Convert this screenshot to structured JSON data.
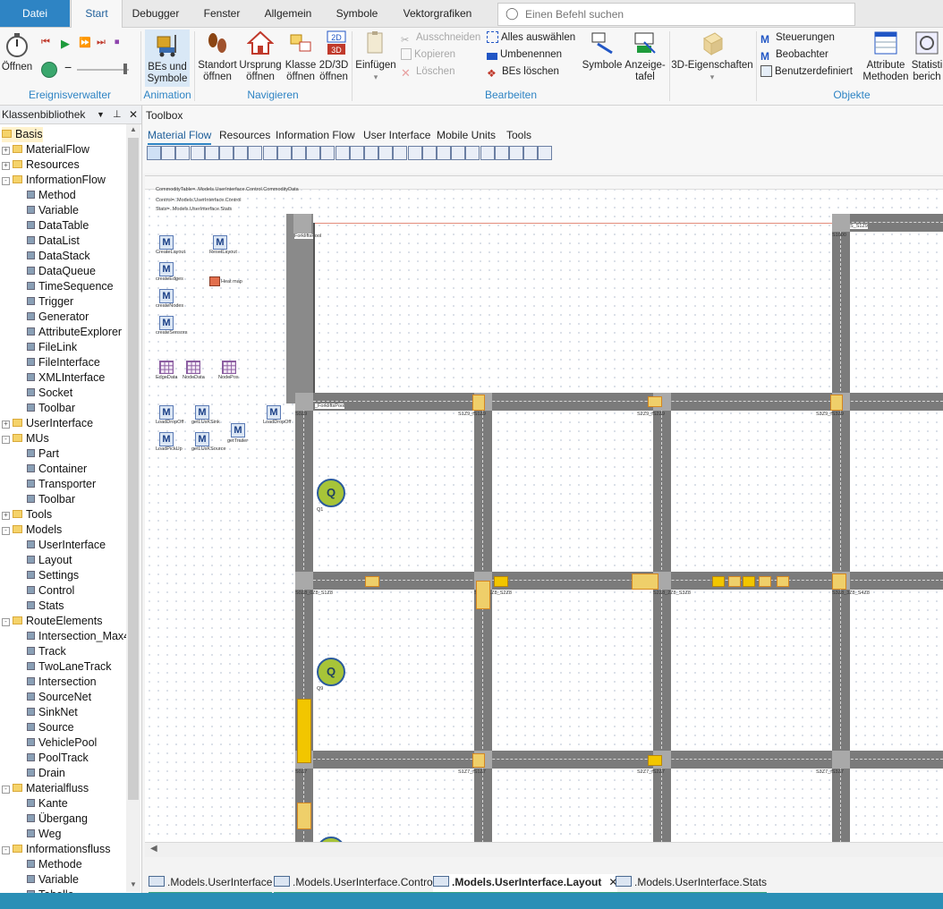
{
  "menu": {
    "tabs": [
      "Datei",
      "Start",
      "Debugger",
      "Fenster",
      "Allgemein",
      "Symbole",
      "Vektorgrafiken"
    ],
    "search_placeholder": "Einen Befehl suchen"
  },
  "ribbon": {
    "ereignis": {
      "open": "Öffnen",
      "group": "Ereignisverwalter"
    },
    "animation": {
      "bes_l1": "BEs und",
      "bes_l2": "Symbole",
      "group": "Animation"
    },
    "navigieren": {
      "standort_l1": "Standort",
      "standort_l2": "öffnen",
      "ursprung_l1": "Ursprung",
      "ursprung_l2": "öffnen",
      "klasse_l1": "Klasse",
      "klasse_l2": "öffnen",
      "view_l1": "2D/3D",
      "view_l2": "öffnen",
      "group": "Navigieren"
    },
    "bearbeiten": {
      "einfuegen": "Einfügen",
      "ausschneiden": "Ausschneiden",
      "kopieren": "Kopieren",
      "loeschen": "Löschen",
      "alles": "Alles auswählen",
      "umbenennen": "Umbenennen",
      "bes_loeschen": "BEs löschen",
      "symbole": "Symbole",
      "anzeige_l1": "Anzeige-",
      "anzeige_l2": "tafel",
      "group": "Bearbeiten"
    },
    "eigen": {
      "label": "3D-Eigenschaften"
    },
    "objekte": {
      "steuerungen": "Steuerungen",
      "beobachter": "Beobachter",
      "benutzer": "Benutzerdefiniert",
      "attr_l1": "Attribute",
      "attr_l2": "Methoden",
      "stat_l1": "Statisti",
      "stat_l2": "berich",
      "group": "Objekte"
    }
  },
  "leftpanel": {
    "title": "Klassenbibliothek",
    "items": [
      {
        "label": "Basis",
        "level": 0,
        "folder": true
      },
      {
        "label": "MaterialFlow",
        "level": 1,
        "folder": true,
        "exp": "+"
      },
      {
        "label": "Resources",
        "level": 1,
        "folder": true,
        "exp": "+"
      },
      {
        "label": "InformationFlow",
        "level": 1,
        "folder": true,
        "exp": "-"
      },
      {
        "label": "Method",
        "level": 2
      },
      {
        "label": "Variable",
        "level": 2
      },
      {
        "label": "DataTable",
        "level": 2
      },
      {
        "label": "DataList",
        "level": 2
      },
      {
        "label": "DataStack",
        "level": 2
      },
      {
        "label": "DataQueue",
        "level": 2
      },
      {
        "label": "TimeSequence",
        "level": 2
      },
      {
        "label": "Trigger",
        "level": 2
      },
      {
        "label": "Generator",
        "level": 2
      },
      {
        "label": "AttributeExplorer",
        "level": 2
      },
      {
        "label": "FileLink",
        "level": 2
      },
      {
        "label": "FileInterface",
        "level": 2
      },
      {
        "label": "XMLInterface",
        "level": 2
      },
      {
        "label": "Socket",
        "level": 2
      },
      {
        "label": "Toolbar",
        "level": 2
      },
      {
        "label": "UserInterface",
        "level": 1,
        "folder": true,
        "exp": "+"
      },
      {
        "label": "MUs",
        "level": 1,
        "folder": true,
        "exp": "-"
      },
      {
        "label": "Part",
        "level": 2
      },
      {
        "label": "Container",
        "level": 2
      },
      {
        "label": "Transporter",
        "level": 2
      },
      {
        "label": "Toolbar",
        "level": 2
      },
      {
        "label": "Tools",
        "level": 1,
        "folder": true,
        "exp": "+"
      },
      {
        "label": "Models",
        "level": 1,
        "folder": true,
        "exp": "-"
      },
      {
        "label": "UserInterface",
        "level": 2
      },
      {
        "label": "Layout",
        "level": 2
      },
      {
        "label": "Settings",
        "level": 2
      },
      {
        "label": "Control",
        "level": 2
      },
      {
        "label": "Stats",
        "level": 2
      },
      {
        "label": "RouteElements",
        "level": 1,
        "folder": true,
        "exp": "-"
      },
      {
        "label": "Intersection_Max4",
        "level": 2
      },
      {
        "label": "Track",
        "level": 2
      },
      {
        "label": "TwoLaneTrack",
        "level": 2
      },
      {
        "label": "Intersection",
        "level": 2
      },
      {
        "label": "SourceNet",
        "level": 2
      },
      {
        "label": "SinkNet",
        "level": 2
      },
      {
        "label": "Source",
        "level": 2
      },
      {
        "label": "VehiclePool",
        "level": 2
      },
      {
        "label": "PoolTrack",
        "level": 2
      },
      {
        "label": "Drain",
        "level": 2
      },
      {
        "label": "Materialfluss",
        "level": 1,
        "folder": true,
        "exp": "-"
      },
      {
        "label": "Kante",
        "level": 2
      },
      {
        "label": "Übergang",
        "level": 2
      },
      {
        "label": "Weg",
        "level": 2
      },
      {
        "label": "Informationsfluss",
        "level": 1,
        "folder": true,
        "exp": "-"
      },
      {
        "label": "Methode",
        "level": 2
      },
      {
        "label": "Variable",
        "level": 2
      },
      {
        "label": "Tabelle",
        "level": 2
      }
    ]
  },
  "toolbox": {
    "title": "Toolbox",
    "tabs": [
      "Material Flow",
      "Resources",
      "Information Flow",
      "User Interface",
      "Mobile Units",
      "Tools"
    ]
  },
  "canvas": {
    "info": [
      "CommodityTable=..Models.UserInterface.Control.CommodityData",
      "Control=..Models.UserInterface.Control",
      "Stats=..Models.UserInterface.Stats"
    ],
    "methods": [
      {
        "label": "CreateLayout"
      },
      {
        "label": "ResetLayout"
      },
      {
        "label": "createEdges"
      },
      {
        "label": "createNodes"
      },
      {
        "label": "createSensors"
      },
      {
        "label": "LoadDropOff"
      },
      {
        "label": "getLUsKSink"
      },
      {
        "label": "LoadDropOff"
      },
      {
        "label": "LoadPickUp"
      },
      {
        "label": "getLUsKSource"
      },
      {
        "label": "getTrailer"
      }
    ],
    "heatmap": "Heat map",
    "tables": [
      {
        "label": "EdgeData"
      },
      {
        "label": "NodeData"
      },
      {
        "label": "NodePos"
      }
    ],
    "sources": [
      {
        "label": "Q1"
      },
      {
        "label": "Q9"
      }
    ],
    "q_letter": "Q",
    "road_labels": {
      "forklifts": "ForkliftsPool",
      "forklifts2": "_ForkliftsPool",
      "s1000": "S1000",
      "s1000b": "S_S1Z9",
      "s0z9": "S0Z9",
      "s1z9": "S1Z9_fS1Z9",
      "s2z9": "S2Z9_fS2Z9",
      "s3z9": "S3Z9_fS3Z9",
      "s0z8": "S0Z8_0Z8_S1Z8",
      "s1z8": "S1Z8_1Z8_S2Z8",
      "s2z8": "S2Z8_2Z8_S3Z8",
      "s3z8": "S3Z8_3Z8_S4Z8",
      "s0z7": "S0Z7",
      "s1z7": "S1Z7_fS1Z7",
      "s2z7": "S2Z7_fS2Z7",
      "s3z7": "S3Z7_fS3Z7"
    }
  },
  "doctabs": [
    {
      "label": ".Models.UserInterface",
      "active": false
    },
    {
      "label": ".Models.UserInterface.Control",
      "active": false
    },
    {
      "label": ".Models.UserInterface.Layout",
      "active": true
    },
    {
      "label": ".Models.UserInterface.Stats",
      "active": false
    }
  ],
  "colors": {
    "accent": "#2e84c4",
    "status": "#2a8fb6",
    "road": "#7b7b7b",
    "mu": "#efcf6a"
  }
}
